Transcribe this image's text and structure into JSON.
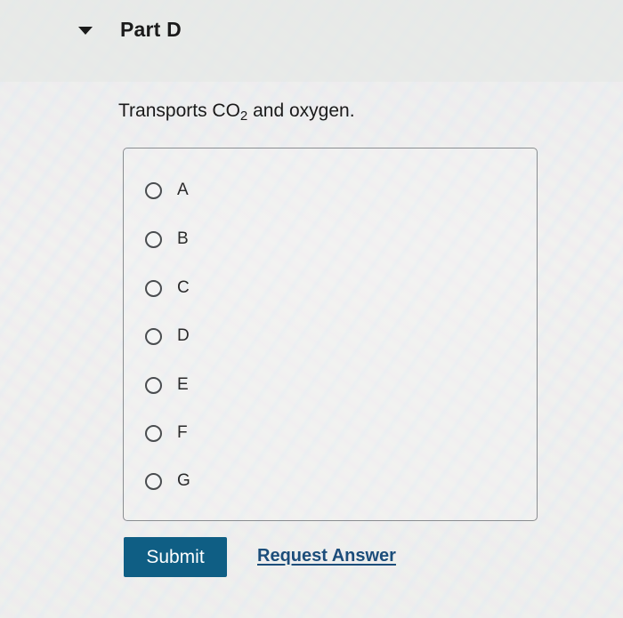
{
  "part": {
    "title": "Part D",
    "expanded": true
  },
  "question": {
    "prefix": "Transports CO",
    "subscript": "2",
    "suffix": " and oxygen."
  },
  "options": [
    {
      "label": "A",
      "selected": false
    },
    {
      "label": "B",
      "selected": false
    },
    {
      "label": "C",
      "selected": false
    },
    {
      "label": "D",
      "selected": false
    },
    {
      "label": "E",
      "selected": false
    },
    {
      "label": "F",
      "selected": false
    },
    {
      "label": "G",
      "selected": false
    }
  ],
  "actions": {
    "submit_label": "Submit",
    "request_answer_label": "Request Answer"
  },
  "colors": {
    "submit_bg": "#0f5e84",
    "link": "#1c4d7a"
  }
}
